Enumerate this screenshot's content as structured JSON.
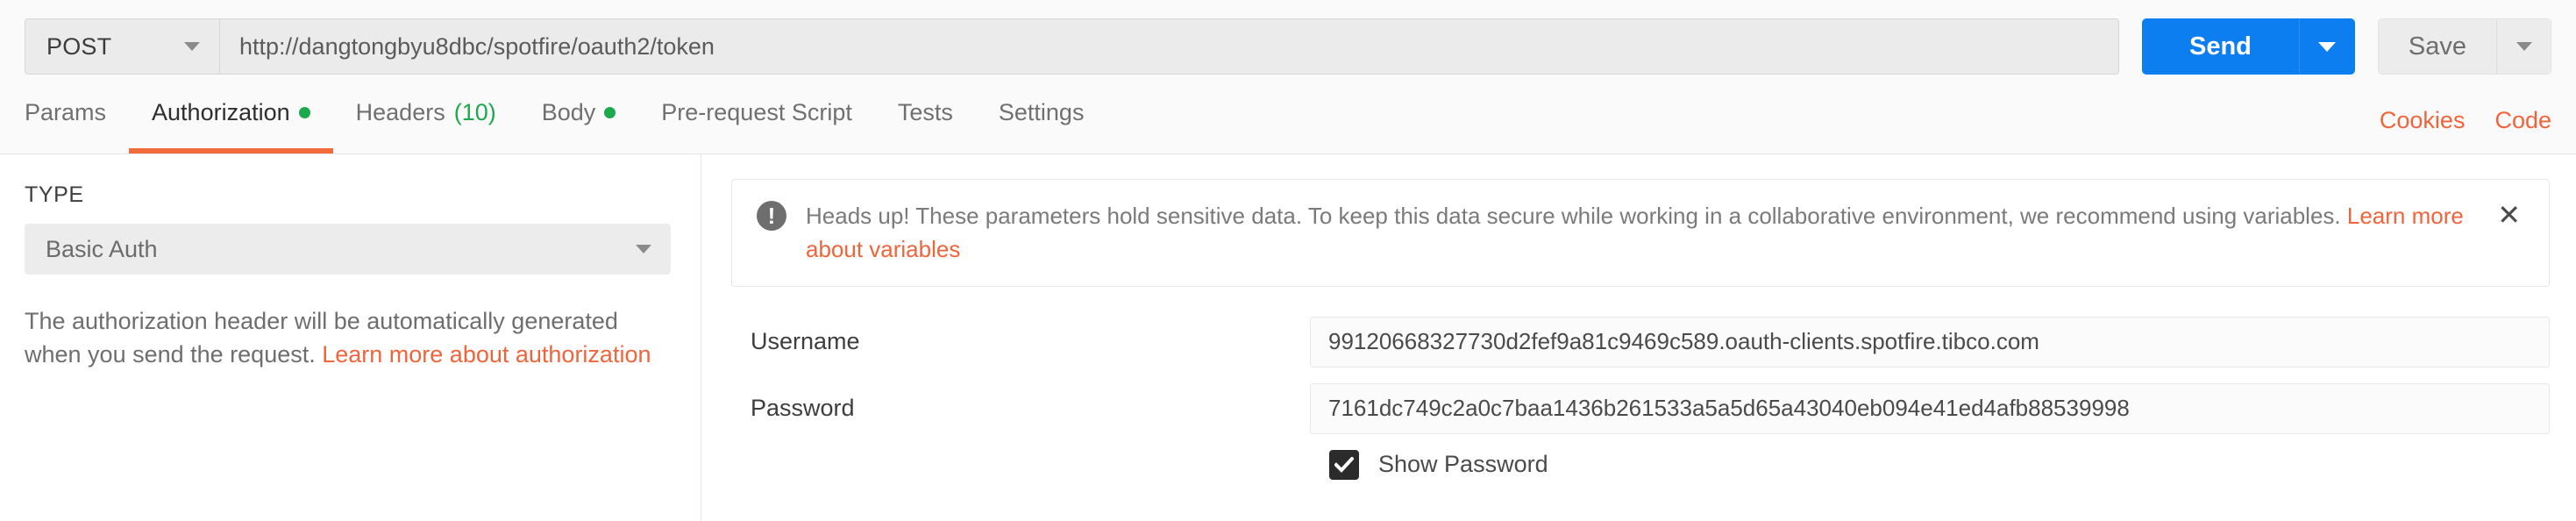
{
  "request": {
    "method": "POST",
    "url": "http://dangtongbyu8dbc/spotfire/oauth2/token",
    "send_label": "Send",
    "save_label": "Save"
  },
  "tabs": [
    {
      "label": "Params",
      "active": false,
      "dot": false,
      "count": ""
    },
    {
      "label": "Authorization",
      "active": true,
      "dot": true,
      "count": ""
    },
    {
      "label": "Headers",
      "active": false,
      "dot": false,
      "count": "(10)"
    },
    {
      "label": "Body",
      "active": false,
      "dot": true,
      "count": ""
    },
    {
      "label": "Pre-request Script",
      "active": false,
      "dot": false,
      "count": ""
    },
    {
      "label": "Tests",
      "active": false,
      "dot": false,
      "count": ""
    },
    {
      "label": "Settings",
      "active": false,
      "dot": false,
      "count": ""
    }
  ],
  "tab_links": {
    "cookies": "Cookies",
    "code": "Code"
  },
  "auth": {
    "type_label": "TYPE",
    "type_value": "Basic Auth",
    "help_text": "The authorization header will be automatically generated when you send the request. ",
    "help_link": "Learn more about authorization"
  },
  "banner": {
    "icon_glyph": "!",
    "text": "Heads up! These parameters hold sensitive data. To keep this data secure while working in a collaborative environment, we recommend using variables. ",
    "link": "Learn more about variables",
    "close_glyph": "✕"
  },
  "fields": {
    "username_label": "Username",
    "username_value": "99120668327730d2fef9a81c9469c589.oauth-clients.spotfire.tibco.com",
    "password_label": "Password",
    "password_value": "7161dc749c2a0c7baa1436b261533a5a5d65a43040eb094e41ed4afb88539998",
    "show_password_label": "Show Password",
    "show_password_checked": true
  },
  "colors": {
    "accent_orange": "#f1643b",
    "send_blue": "#0d7ef0",
    "status_green": "#1ba94c"
  }
}
